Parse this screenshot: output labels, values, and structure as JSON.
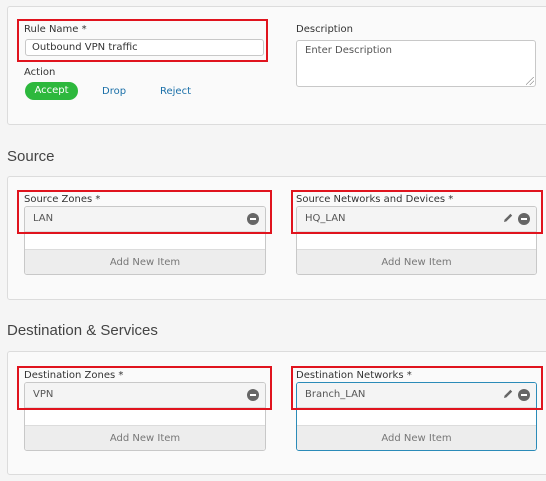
{
  "rule": {
    "name_label": "Rule Name",
    "name_value": "Outbound VPN traffic",
    "description_label": "Description",
    "description_placeholder": "Enter Description",
    "action_label": "Action",
    "actions": [
      "Accept",
      "Drop",
      "Reject"
    ],
    "selected_action": "Accept"
  },
  "source": {
    "title": "Source",
    "zones": {
      "label": "Source Zones",
      "items": [
        "LAN"
      ],
      "add_label": "Add New Item"
    },
    "networks": {
      "label": "Source Networks and Devices",
      "items": [
        "HQ_LAN"
      ],
      "add_label": "Add New Item"
    }
  },
  "destination": {
    "title": "Destination & Services",
    "zones": {
      "label": "Destination Zones",
      "items": [
        "VPN"
      ],
      "add_label": "Add New Item"
    },
    "networks": {
      "label": "Destination Networks",
      "items": [
        "Branch_LAN"
      ],
      "add_label": "Add New Item"
    }
  },
  "colors": {
    "accept": "#2db83d",
    "link": "#1a6fa8",
    "highlight": "#e0141e",
    "focus": "#2b8bb8"
  }
}
